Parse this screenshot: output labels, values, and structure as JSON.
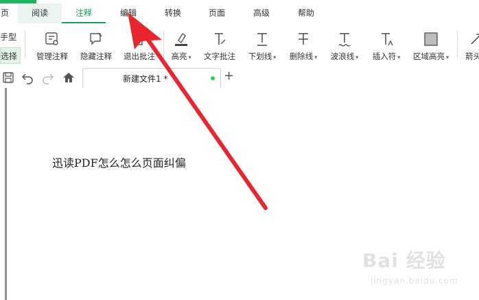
{
  "menubar": {
    "tabs": [
      {
        "label": "页"
      },
      {
        "label": "阅读"
      },
      {
        "label": "注释"
      },
      {
        "label": "编辑"
      },
      {
        "label": "转换"
      },
      {
        "label": "页面"
      },
      {
        "label": "高级"
      },
      {
        "label": "帮助"
      }
    ],
    "active_tab": "注释",
    "accent_color": "#1c9e57"
  },
  "left_partial": {
    "top_label": "手型",
    "bottom_label": "选择"
  },
  "ribbon": {
    "tools": [
      {
        "label": "管理注释",
        "icon": "manage-annotations-icon"
      },
      {
        "label": "隐藏注释",
        "icon": "hide-annotations-icon"
      },
      {
        "label": "退出批注",
        "icon": "exit-annotation-icon"
      },
      {
        "label": "高亮",
        "icon": "highlight-icon",
        "dropdown": true
      },
      {
        "label": "文字批注",
        "icon": "text-annotation-icon"
      },
      {
        "label": "下划线",
        "icon": "underline-icon",
        "dropdown": true
      },
      {
        "label": "删除线",
        "icon": "strikethrough-icon",
        "dropdown": true
      },
      {
        "label": "波浪线",
        "icon": "wavy-line-icon",
        "dropdown": true
      },
      {
        "label": "插入符",
        "icon": "caret-insert-icon",
        "dropdown": true
      },
      {
        "label": "区域高亮",
        "icon": "area-highlight-icon",
        "dropdown": true
      },
      {
        "label": "箭头",
        "icon": "arrow-icon"
      }
    ],
    "dropdown_glyph": "▾"
  },
  "tabbar": {
    "doc_tab_title": "新建文件1 *",
    "new_tab_glyph": "+",
    "unsaved_dot_color": "#2ecc55"
  },
  "document": {
    "text": "迅读PDF怎么怎么页面纠偏"
  },
  "watermark": {
    "line1": "Bai 经验",
    "line2": "jingyan.baidu.com"
  },
  "annotation_arrow_color": "#e8262f"
}
